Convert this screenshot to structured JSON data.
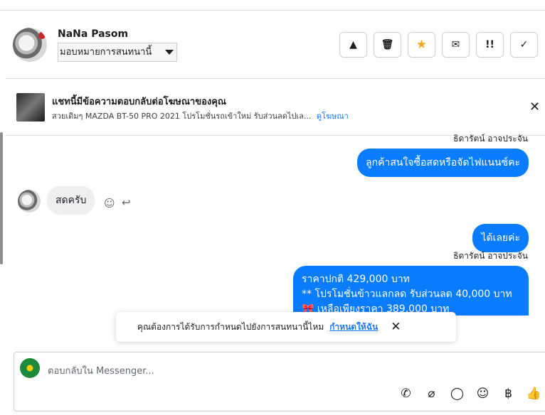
{
  "header": {
    "contact_name": "NaNa Pasom",
    "assign_label": "มอบหมายการสนทนานี้",
    "tools": [
      {
        "name": "spam-button",
        "icon": "▲",
        "icon_name": "warning-icon"
      },
      {
        "name": "delete-button",
        "icon": "🗑",
        "icon_name": "trash-icon"
      },
      {
        "name": "star-button",
        "icon": "★",
        "icon_name": "star-icon"
      },
      {
        "name": "mark-unread-button",
        "icon": "✉",
        "icon_name": "envelope-icon"
      },
      {
        "name": "follow-up-button",
        "icon": "!!",
        "icon_name": "follow-up-icon"
      },
      {
        "name": "done-button",
        "icon": "✓",
        "icon_name": "check-icon"
      }
    ]
  },
  "ad_banner": {
    "title": "แชทนี้มีข้อความตอบกลับต่อโฆษณาของคุณ",
    "description": "สวยเดิมๆ MAZDA BT-50 PRO 2021 โปรโมชั่นรถเข้าใหม่ รับส่วนลดไปเล...",
    "link": "ดูโฆษณา"
  },
  "messages": {
    "sender_1": "ธิดารัตน์ อาจประจัน",
    "out_1": "ลูกค้าสนใจซื้อสดหรือจัดไฟแนนซ์คะ",
    "in_1": "สดครับ",
    "out_2": "ได้เลยค่ะ",
    "sender_2": "ธิดารัตน์ อาจประจัน",
    "out_3_line1": "ราคาปกติ 429,000 บาท",
    "out_3_line2": "** โปรโมชั่นข้าวแลกลด รับส่วนลด 40,000 บาท",
    "out_3_line3": "🎀 เหลือเพียงราคา 389,000 บาท"
  },
  "toast": {
    "text": "คุณต้องการได้รับการกำหนดไปยังการสนทนานี้ไหม",
    "link": "กำหนดให้ฉัน"
  },
  "composer": {
    "placeholder": "ตอบกลับใน Messenger..."
  },
  "colors": {
    "accent": "#0a7cff",
    "star": "#f5a623"
  }
}
